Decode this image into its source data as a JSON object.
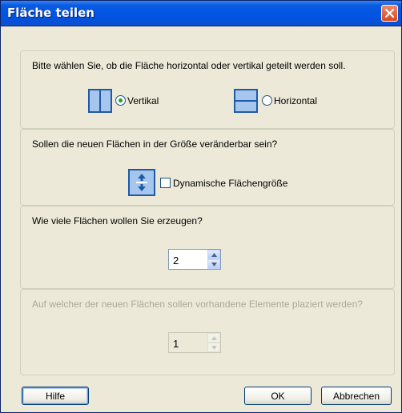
{
  "window": {
    "title": "Fläche teilen"
  },
  "section_direction": {
    "question": "Bitte wählen Sie, ob die Fläche horizontal oder vertikal geteilt werden soll.",
    "options": [
      {
        "label": "Vertikal",
        "selected": true,
        "icon": "vertical-split-icon"
      },
      {
        "label": "Horizontal",
        "selected": false,
        "icon": "horizontal-split-icon"
      }
    ]
  },
  "section_resizable": {
    "question": "Sollen die neuen Flächen in der Größe veränderbar sein?",
    "checkbox_label": "Dynamische Flächengröße",
    "checked": false,
    "icon": "resize-arrows-icon"
  },
  "section_count": {
    "question": "Wie viele Flächen wollen Sie erzeugen?",
    "value": "2"
  },
  "section_target": {
    "question": "Auf welcher der neuen Flächen sollen vorhandene Elemente plaziert werden?",
    "value": "1",
    "disabled": true
  },
  "buttons": {
    "help": "Hilfe",
    "ok": "OK",
    "cancel": "Abbrechen"
  },
  "colors": {
    "titlebar": "#0054e3",
    "dialog_bg": "#ece9d8",
    "icon_fill": "#a6c6ee",
    "icon_border": "#1f5aa8"
  }
}
